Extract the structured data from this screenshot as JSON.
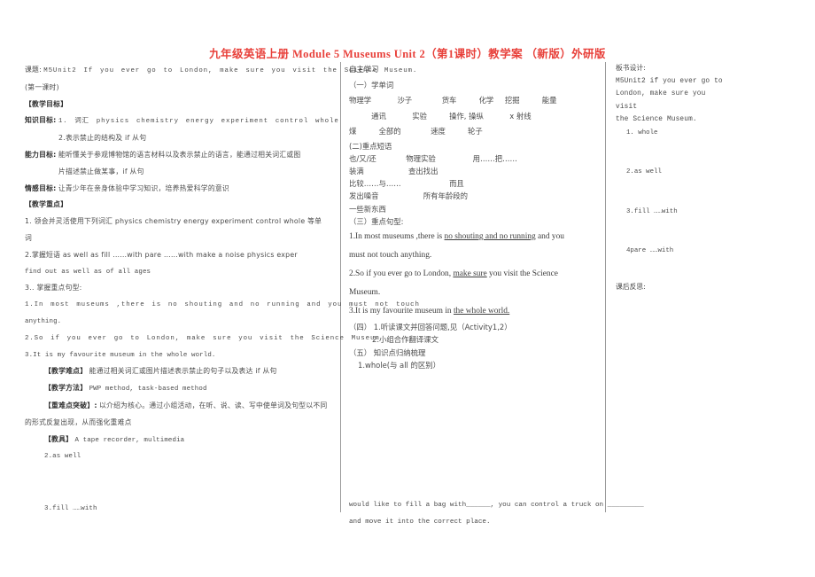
{
  "title": "九年级英语上册 Module 5 Museums Unit 2（第1课时）教学案 （新版）外研版",
  "title_color": "#e8403a",
  "left": {
    "topic_label": "课题:",
    "topic_text": "M5Unit2 If you ever go to London, make sure you visit the Science Museum.",
    "topic_line2": "(第一课时)",
    "h_objectives": "【教学目标】",
    "knowledge_label": "知识目标:",
    "knowledge_1": "1. 词汇 physics chemistry energy experiment control whole",
    "knowledge_2": "2.表示禁止的结构及 if 从句",
    "ability_label": "能力目标:",
    "ability_text_1": "能听懂关于参观博物馆的语言材料以及表示禁止的语言，能通过相关词汇或图",
    "ability_text_2": "片描述禁止做某事，if 从句",
    "emotion_label": "情感目标:",
    "emotion_text": "让青少年在亲身体验中学习知识，培养热爱科学的意识",
    "h_keypoints": "【教学重点】",
    "kp_1a": "1. 领会并灵活使用下列词汇 physics chemistry energy experiment control whole 等单",
    "kp_1b": "词",
    "kp_2a": "2.掌握短语 as well as  fill ……with  pare ……with  make a noise  physics exper",
    "kp_2b": "find out  as well as  of all ages",
    "kp_3": "3.. 掌握重点句型:",
    "sent_1a": "1.In most museums ,there is no shouting and no running and you must not touch",
    "sent_1b": "anything.",
    "sent_2": "2.So if you ever go to London, make sure you visit the Science Museum",
    "sent_3": "3.It is my favourite museum in the whole world.",
    "h_difficult_label": "【教学难点】",
    "h_difficult_text": "能通过相关词汇或图片描述表示禁止的句子以及表达 if 从句",
    "h_method_label": "【教学方法】",
    "h_method_text": "PWP method, task-based method",
    "h_break_label": "【重难点突破】:",
    "h_break_text_1": "以介绍为核心。通过小组活动，在听、说、读、写中使单词及句型以不同",
    "h_break_text_2": "的形式反复出现，从而强化重难点",
    "h_tools_label": "【教具】",
    "h_tools_text": "A tape recorder, multimedia",
    "item_2": "2.as well",
    "item_3": "3.fill ……with"
  },
  "middle": {
    "heading": "自主学习",
    "sec1_title": "（一）学单词",
    "vocab_line1": [
      "物理学",
      "沙子",
      "货车",
      "化学",
      "挖掘",
      "能量"
    ],
    "vocab_line2": [
      "通讯",
      "实验",
      "操作, 操纵",
      "x 射线"
    ],
    "vocab_line3": [
      "煤",
      "全部的",
      "速度",
      "轮子"
    ],
    "sec2_title": "(二)重点短语",
    "phrases": [
      "也/又/还",
      "物理实验",
      "用……把……",
      "装满",
      "查出找出",
      "比较……与……",
      "而且",
      "发出噪音",
      "所有年龄段的",
      "一些新东西"
    ],
    "sec3_title": "（三）重点句型:",
    "sent_1_pre": "1.In most museums ,there is ",
    "sent_1_u1": "no shouting and no running",
    "sent_1_post": " and you",
    "sent_1_line2": "must not touch anything.",
    "sent_2_pre": "2.So if you ever go to London, ",
    "sent_2_u1": "make sure",
    "sent_2_post": " you visit the Science",
    "sent_2_line2": "Museum.",
    "sent_3_pre": "3.It is my favourite museum in ",
    "sent_3_u1": "the whole world.",
    "sec4_line1": "（四） 1.听读课文并回答问题,见（Activity1,2）",
    "sec4_line2": "2.小组合作翻译课文",
    "sec5_line1": "（五） 知识点归纳梳理",
    "sec5_line2": "1.whole(与 all 的区别）",
    "footer_line1": "would like to fill a bag with______, you can control a truck on _________",
    "footer_line2": "and move it into the correct place."
  },
  "right": {
    "heading": "板书设计:",
    "line_1": "M5Unit2 if you ever go to",
    "line_2": "London, make sure you visit",
    "line_3": "the Science Museum.",
    "item_1": "1. whole",
    "item_2": "2.as well",
    "item_3": "3.fill ……with",
    "item_4": "4pare ……with",
    "reflection": "课后反思:"
  }
}
